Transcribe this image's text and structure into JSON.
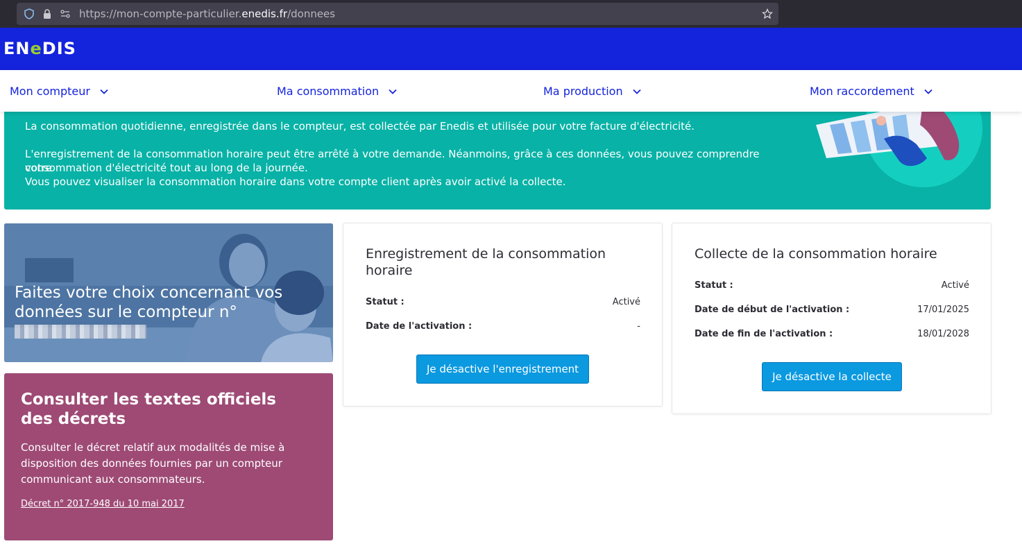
{
  "browser": {
    "url_prefix": "https://mon-compte-particulier.",
    "url_domain": "enedis.fr",
    "url_path": "/donnees"
  },
  "header": {
    "logo_part1": "EN",
    "logo_part2": "e",
    "logo_part3": "DIS",
    "color": "#1423dc"
  },
  "nav": {
    "items": [
      {
        "label": "Mon compteur"
      },
      {
        "label": "Ma consommation"
      },
      {
        "label": "Ma production"
      },
      {
        "label": "Mon raccordement"
      }
    ]
  },
  "banner": {
    "p1": "La consommation quotidienne, enregistrée dans le compteur, est collectée par Enedis et utilisée pour votre facture d'électricité.",
    "p2_line1": "L'enregistrement de la consommation horaire peut être arrêté à votre demande. Néanmoins, grâce à ces données, vous pouvez comprendre votre",
    "p2_line2": "consommation d'électricité tout au long de la journée.",
    "p2_line3": "Vous pouvez visualiser la consommation horaire dans votre compte client après avoir activé la collecte.",
    "color": "#08b2a6"
  },
  "photo_card": {
    "title": "Faites votre choix concernant vos données sur le compteur",
    "meter_prefix": "n°"
  },
  "decree_card": {
    "title": "Consulter les textes officiels des décrets",
    "text": "Consulter le décret relatif aux modalités de mise à disposition des données fournies par un compteur communicant aux consommateurs.",
    "link": "Décret n° 2017-948 du 10 mai 2017",
    "color": "#9e4a75"
  },
  "recording_card": {
    "title": "Enregistrement de la consommation horaire",
    "status_label": "Statut :",
    "status_value": "Activé",
    "activation_label": "Date de l'activation :",
    "activation_value": "-",
    "button": "Je désactive l'enregistrement"
  },
  "collect_card": {
    "title": "Collecte de la consommation horaire",
    "status_label": "Statut :",
    "status_value": "Activé",
    "start_label": "Date de début de l'activation :",
    "start_value": "17/01/2025",
    "end_label": "Date de fin de l'activation :",
    "end_value": "18/01/2028",
    "button": "Je désactive la collecte"
  },
  "colors": {
    "button": "#0b99e0",
    "nav_text": "#1423dc"
  }
}
